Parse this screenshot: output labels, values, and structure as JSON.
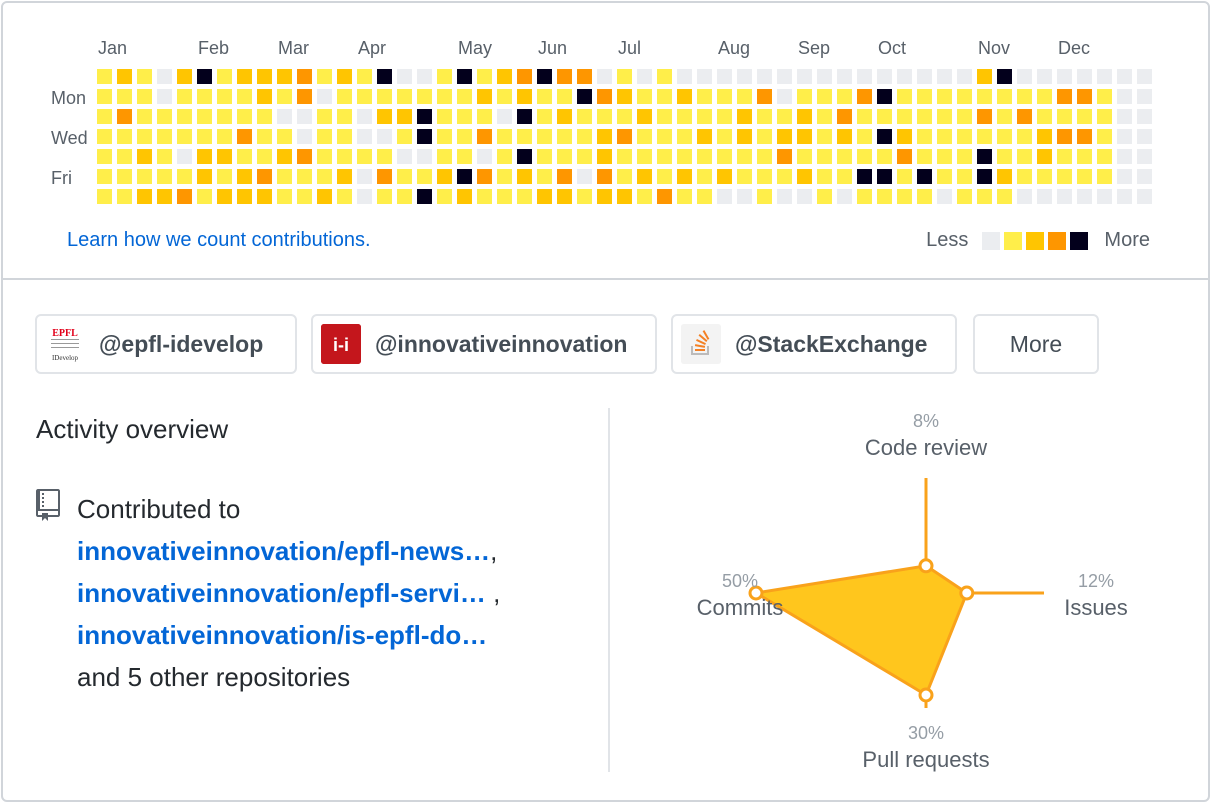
{
  "calendar": {
    "months": [
      "Jan",
      "Feb",
      "Mar",
      "Apr",
      "May",
      "Jun",
      "Jul",
      "Aug",
      "Sep",
      "Oct",
      "Nov",
      "Dec"
    ],
    "weekdays": [
      "Mon",
      "Wed",
      "Fri"
    ],
    "levels": [
      "#ebedf0",
      "#ffee4a",
      "#ffc501",
      "#fe9600",
      "#03001c"
    ],
    "weeks": [
      [
        1,
        1,
        1,
        1,
        1,
        1,
        1
      ],
      [
        2,
        1,
        3,
        1,
        1,
        1,
        1
      ],
      [
        1,
        1,
        1,
        1,
        2,
        1,
        2
      ],
      [
        0,
        0,
        1,
        1,
        1,
        1,
        2
      ],
      [
        2,
        1,
        1,
        1,
        0,
        1,
        3
      ],
      [
        4,
        1,
        1,
        1,
        2,
        2,
        1
      ],
      [
        1,
        1,
        1,
        1,
        2,
        1,
        2
      ],
      [
        2,
        1,
        1,
        3,
        1,
        2,
        2
      ],
      [
        2,
        2,
        1,
        1,
        1,
        3,
        2
      ],
      [
        2,
        1,
        0,
        1,
        2,
        1,
        1
      ],
      [
        3,
        3,
        0,
        0,
        3,
        1,
        1
      ],
      [
        1,
        0,
        1,
        1,
        1,
        1,
        2
      ],
      [
        2,
        1,
        1,
        1,
        1,
        2,
        1
      ],
      [
        1,
        1,
        0,
        0,
        1,
        0,
        0
      ],
      [
        4,
        1,
        2,
        0,
        1,
        3,
        1
      ],
      [
        0,
        1,
        2,
        1,
        0,
        1,
        1
      ],
      [
        0,
        1,
        4,
        4,
        0,
        1,
        4
      ],
      [
        1,
        1,
        1,
        1,
        1,
        2,
        1
      ],
      [
        4,
        1,
        1,
        1,
        1,
        4,
        2
      ],
      [
        1,
        2,
        1,
        3,
        0,
        3,
        1
      ],
      [
        2,
        1,
        0,
        1,
        1,
        1,
        1
      ],
      [
        3,
        2,
        4,
        1,
        4,
        2,
        1
      ],
      [
        4,
        1,
        1,
        1,
        1,
        1,
        2
      ],
      [
        3,
        1,
        2,
        1,
        1,
        3,
        2
      ],
      [
        3,
        4,
        1,
        1,
        1,
        0,
        1
      ],
      [
        0,
        3,
        1,
        2,
        2,
        3,
        2
      ],
      [
        1,
        2,
        1,
        3,
        1,
        1,
        2
      ],
      [
        0,
        1,
        2,
        1,
        1,
        2,
        1
      ],
      [
        1,
        1,
        1,
        1,
        1,
        1,
        3
      ],
      [
        0,
        2,
        1,
        1,
        1,
        2,
        1
      ],
      [
        0,
        1,
        1,
        2,
        1,
        1,
        1
      ],
      [
        0,
        1,
        1,
        1,
        1,
        2,
        0
      ],
      [
        0,
        1,
        2,
        2,
        1,
        1,
        0
      ],
      [
        0,
        3,
        1,
        1,
        1,
        1,
        1
      ],
      [
        0,
        0,
        1,
        2,
        3,
        1,
        0
      ],
      [
        0,
        1,
        2,
        2,
        1,
        2,
        0
      ],
      [
        0,
        1,
        1,
        1,
        1,
        1,
        1
      ],
      [
        0,
        1,
        3,
        2,
        1,
        1,
        0
      ],
      [
        0,
        3,
        1,
        1,
        1,
        4,
        1
      ],
      [
        0,
        4,
        1,
        4,
        1,
        4,
        1
      ],
      [
        0,
        1,
        1,
        2,
        3,
        1,
        1
      ],
      [
        0,
        1,
        1,
        1,
        1,
        4,
        1
      ],
      [
        0,
        1,
        1,
        1,
        1,
        1,
        0
      ],
      [
        0,
        1,
        1,
        1,
        1,
        1,
        1
      ],
      [
        2,
        1,
        3,
        1,
        4,
        4,
        1
      ],
      [
        4,
        1,
        1,
        1,
        1,
        2,
        1
      ],
      [
        0,
        1,
        3,
        1,
        1,
        1,
        0
      ],
      [
        0,
        1,
        1,
        2,
        2,
        1,
        0
      ],
      [
        0,
        3,
        1,
        3,
        1,
        1,
        0
      ],
      [
        0,
        3,
        1,
        3,
        1,
        1,
        0
      ],
      [
        0,
        1,
        1,
        1,
        1,
        1,
        0
      ],
      [
        0,
        0,
        0,
        0,
        0,
        0,
        0
      ],
      [
        0,
        0,
        0,
        0,
        0,
        0,
        0
      ]
    ],
    "learn_link": "Learn how we count contributions.",
    "legend_less": "Less",
    "legend_more": "More"
  },
  "orgs": [
    {
      "name": "@epfl-idevelop",
      "logo": "epfl-idevelop-logo"
    },
    {
      "name": "@innovativeinnovation",
      "logo": "innovativeinnovation-logo"
    },
    {
      "name": "@StackExchange",
      "logo": "stackexchange-logo"
    }
  ],
  "orgs_more_label": "More",
  "logo_texts": {
    "epfl": "EPFL",
    "idevelop": "IDevelop",
    "innov": "i-i"
  },
  "activity": {
    "title": "Activity overview",
    "icon": "repo-icon",
    "contributed_to": "Contributed to",
    "repos": [
      "innovativeinnovation/epfl-news…",
      "innovativeinnovation/epfl-servi…",
      "innovativeinnovation/is-epfl-do…"
    ],
    "others": "and 5 other repositories"
  },
  "radar": {
    "accent": "#f9a21b",
    "fill": "#ffc61d",
    "code_review": {
      "label": "Code review",
      "pct": "8%",
      "value": 8
    },
    "issues": {
      "label": "Issues",
      "pct": "12%",
      "value": 12
    },
    "pull_requests": {
      "label": "Pull requests",
      "pct": "30%",
      "value": 30
    },
    "commits": {
      "label": "Commits",
      "pct": "50%",
      "value": 50
    }
  }
}
